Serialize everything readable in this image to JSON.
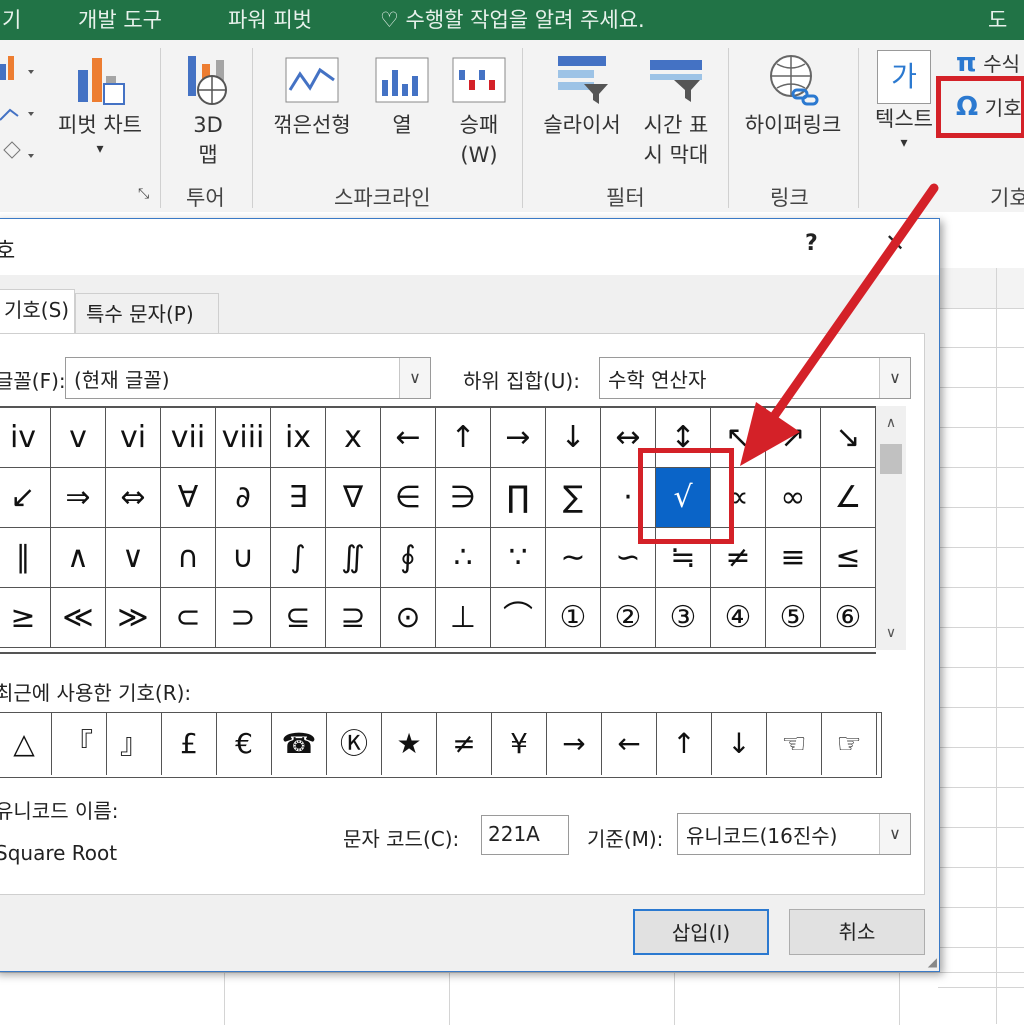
{
  "topbar": {
    "tab_a": "기",
    "tab_b": "개발 도구",
    "tab_c": "파워 피벗",
    "tell_me": "♡ 수행할 작업을 알려 주세요.",
    "right": "도"
  },
  "ribbon": {
    "pivot_chart": "피벗 차트",
    "map3d_line1": "3D",
    "map3d_line2": "맵",
    "line": "꺾은선형",
    "column": "열",
    "winloss_line1": "승패",
    "winloss_line2": "(W)",
    "slicer": "슬라이서",
    "timeline_line1": "시간 표",
    "timeline_line2": "시 막대",
    "hyperlink": "하이퍼링크",
    "text": "텍스트",
    "equation": "수식",
    "symbol": "기호",
    "groups": {
      "tour": "투어",
      "sparklines": "스파크라인",
      "filters": "필터",
      "links": "링크",
      "symbols": "기호"
    }
  },
  "dialog": {
    "title": "호",
    "help": "?",
    "close": "✕",
    "tabs": [
      "기호(S)",
      "특수 문자(P)"
    ],
    "font_label": "글꼴(F):",
    "font_value": "(현재 글꼴)",
    "subset_label": "하위 집합(U):",
    "subset_value": "수학 연산자",
    "symbols": [
      "iv",
      "v",
      "vi",
      "vii",
      "viii",
      "ix",
      "x",
      "←",
      "↑",
      "→",
      "↓",
      "↔",
      "↕",
      "↖",
      "↗",
      "↘",
      "↙",
      "⇒",
      "⇔",
      "∀",
      "∂",
      "∃",
      "∇",
      "∈",
      "∋",
      "∏",
      "∑",
      "·",
      "√",
      "∝",
      "∞",
      "∠",
      "∥",
      "∧",
      "∨",
      "∩",
      "∪",
      "∫",
      "∬",
      "∮",
      "∴",
      "∵",
      "∼",
      "∽",
      "≒",
      "≠",
      "≡",
      "≤",
      "≥",
      "≪",
      "≫",
      "⊂",
      "⊃",
      "⊆",
      "⊇",
      "⊙",
      "⊥",
      "⌒",
      "①",
      "②",
      "③",
      "④",
      "⑤",
      "⑥"
    ],
    "recent_label": "최근에 사용한 기호(R):",
    "recent": [
      "△",
      "『",
      "』",
      "£",
      "€",
      "☎",
      "Ⓚ",
      "★",
      "≠",
      "¥",
      "→",
      "←",
      "↑",
      "↓",
      "☜",
      "☞"
    ],
    "unicode_label": "유니코드 이름:",
    "unicode_name": "Square Root",
    "code_label": "문자 코드(C):",
    "code_value": "221A",
    "from_label": "기준(M):",
    "from_value": "유니코드(16진수)",
    "insert": "삽입(I)",
    "cancel": "취소"
  },
  "colors": {
    "excel_green": "#217346",
    "highlight_red": "#d42128",
    "selection_blue": "#0a64c8"
  }
}
